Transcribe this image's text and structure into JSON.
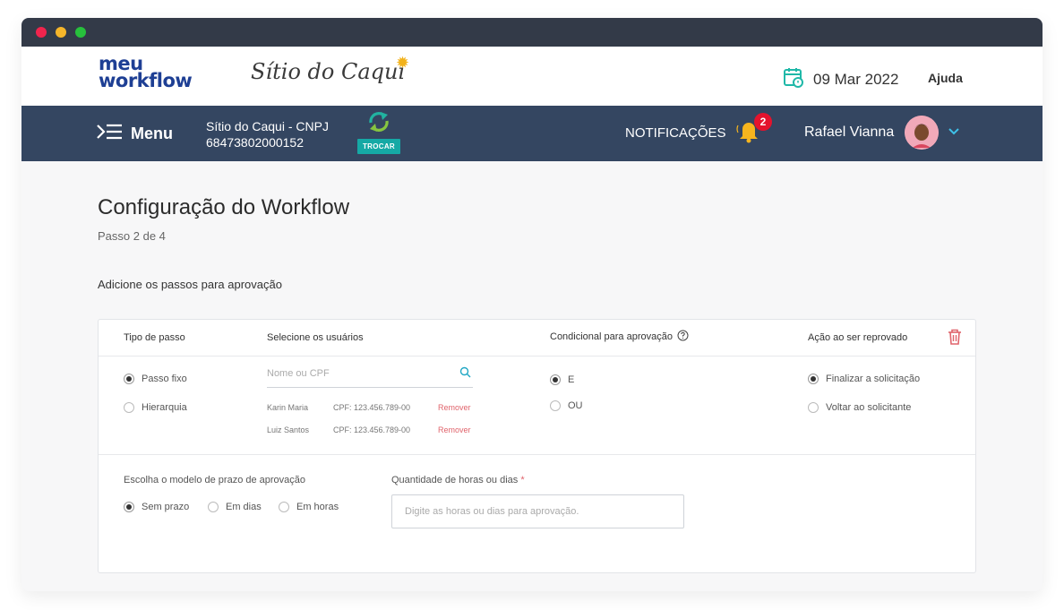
{
  "logo": {
    "line1": "meu",
    "line2": "workflow"
  },
  "brand": {
    "name": "Sítio do Caqui"
  },
  "header": {
    "date": "09 Mar 2022",
    "help": "Ajuda"
  },
  "nav": {
    "menu": "Menu",
    "company_name": "Sítio do Caqui - CNPJ",
    "company_cnpj": "68473802000152",
    "swap": "TROCAR",
    "notifications": "NOTIFICAÇÕES",
    "notif_count": "2",
    "user_name": "Rafael Vianna"
  },
  "page": {
    "title": "Configuração do Workflow",
    "step": "Passo 2 de 4",
    "instruction": "Adicione os passos para aprovação"
  },
  "card": {
    "headers": {
      "step_type": "Tipo de passo",
      "select_users": "Selecione os usuários",
      "conditional": "Condicional para aprovação",
      "reject_action": "Ação ao ser reprovado"
    },
    "step_type": {
      "fixed": "Passo fixo",
      "hierarchy": "Hierarquia",
      "selected": "fixed"
    },
    "search": {
      "placeholder": "Nome ou CPF"
    },
    "users": [
      {
        "name": "Karin Maria",
        "cpf": "CPF: 123.456.789-00",
        "remove": "Remover"
      },
      {
        "name": "Luiz Santos",
        "cpf": "CPF: 123.456.789-00",
        "remove": "Remover"
      }
    ],
    "conditional": {
      "and": "E",
      "or": "OU",
      "selected": "and"
    },
    "reject": {
      "finalize": "Finalizar a solicitação",
      "back": "Voltar ao solicitante",
      "selected": "finalize"
    },
    "deadline": {
      "label": "Escolha o modelo de prazo de aprovação",
      "none": "Sem prazo",
      "days": "Em dias",
      "hours": "Em horas",
      "selected": "none"
    },
    "quantity": {
      "label": "Quantidade de horas ou dias",
      "required": "*",
      "placeholder": "Digite as horas ou dias para aprovação."
    }
  },
  "colors": {
    "navbar": "#344661",
    "titlebar": "#333a48",
    "accent": "#15a9a5",
    "brand_blue": "#1e3f94",
    "danger": "#e0646c",
    "badge": "#e4132d"
  },
  "icons": {
    "calendar": "calendar-icon",
    "menu": "menu-icon",
    "swap": "swap-icon",
    "bell": "bell-icon",
    "chevron": "chevron-down-icon",
    "trash": "trash-icon",
    "search": "search-icon",
    "help": "help-circle-icon"
  }
}
